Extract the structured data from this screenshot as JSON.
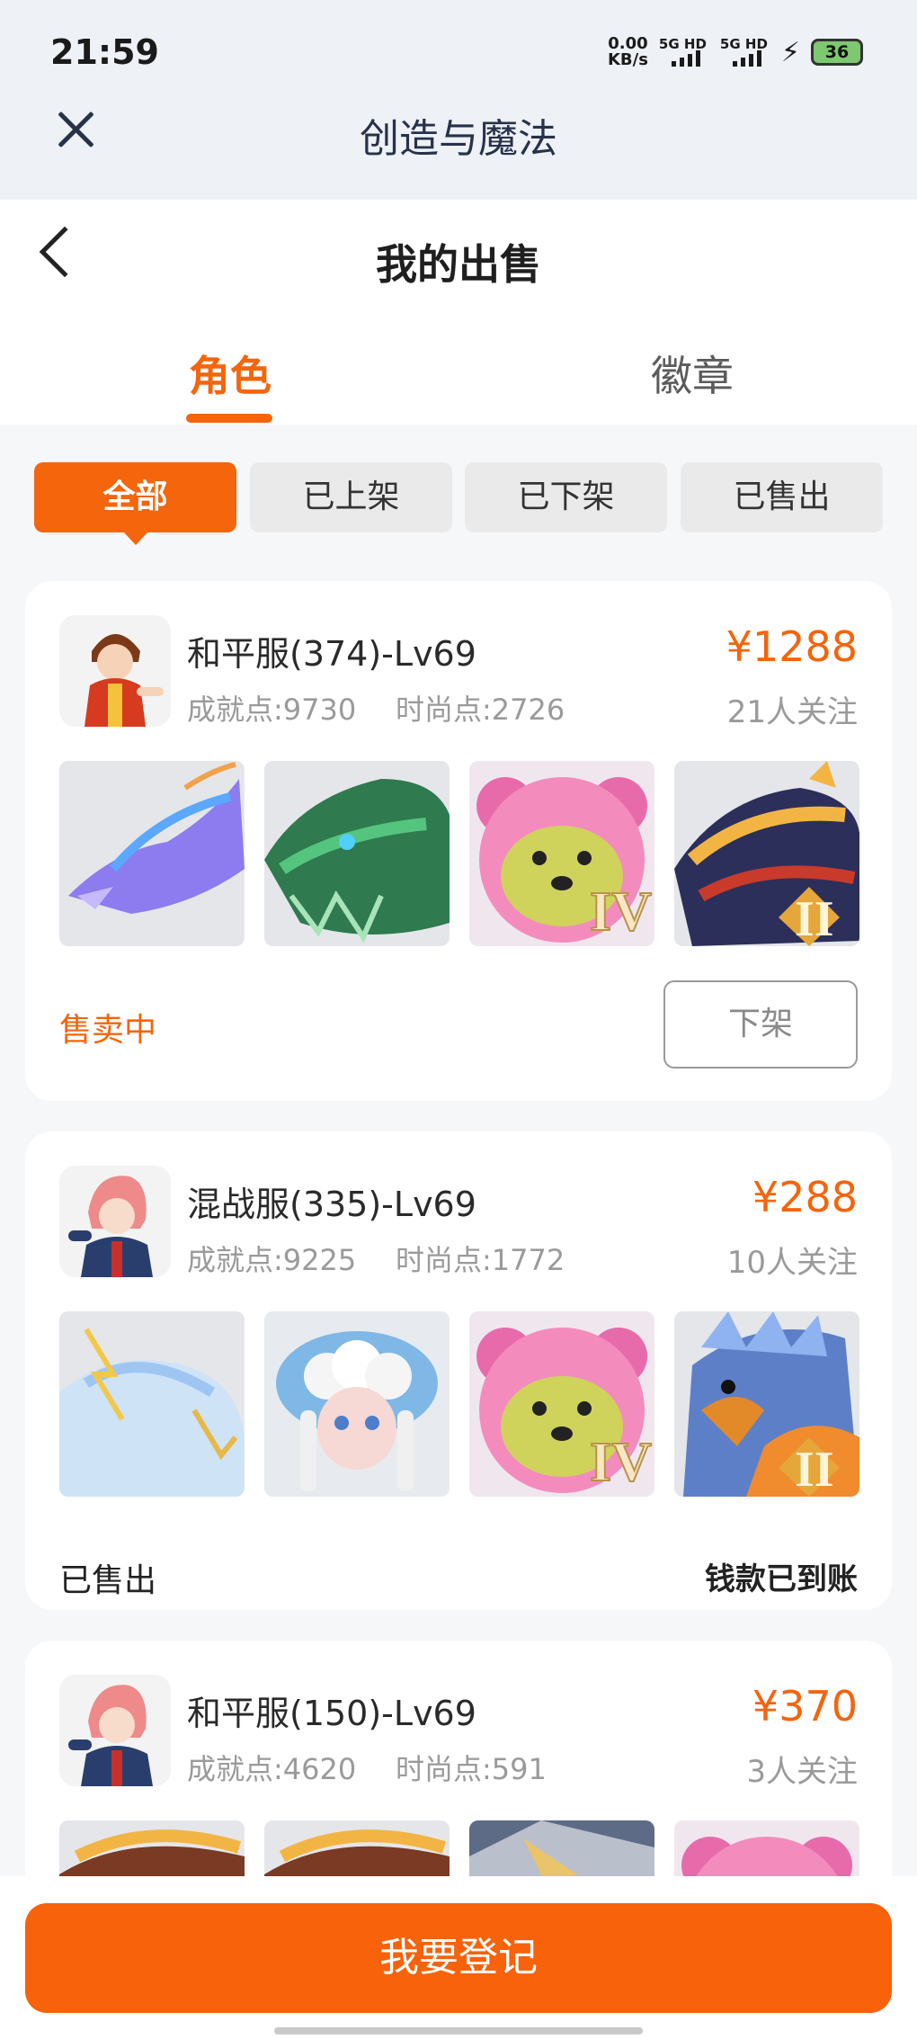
{
  "status_bar": {
    "time": "21:59",
    "net_speed_value": "0.00",
    "net_speed_unit": "KB/s",
    "sim1": "5G HD",
    "sim2": "5G HD",
    "battery": "36"
  },
  "app_bar": {
    "title": "创造与魔法",
    "close_icon": "close-icon"
  },
  "header": {
    "title": "我的出售",
    "back_icon": "back-chevron-icon"
  },
  "tabs": [
    {
      "label": "角色",
      "active": true
    },
    {
      "label": "徽章",
      "active": false
    }
  ],
  "filters": [
    {
      "label": "全部",
      "active": true
    },
    {
      "label": "已上架",
      "active": false
    },
    {
      "label": "已下架",
      "active": false
    },
    {
      "label": "已售出",
      "active": false
    }
  ],
  "listings": [
    {
      "server": "和平服(374)-Lv69",
      "achievement": "成就点:9730",
      "fashion": "时尚点:2726",
      "price": "¥1288",
      "followers": "21人关注",
      "status": "售卖中",
      "action": "下架",
      "thumbs": [
        "purple-dragon-mount",
        "green-dragon-mount",
        "pink-bear-mount",
        "fire-dragon-mount"
      ],
      "thumb_badges": [
        "",
        "",
        "IV",
        "II"
      ]
    },
    {
      "server": "混战服(335)-Lv69",
      "achievement": "成就点:9225",
      "fashion": "时尚点:1772",
      "price": "¥288",
      "followers": "10人关注",
      "status": "已售出",
      "note": "钱款已到账",
      "thumbs": [
        "ice-qilin-mount",
        "cloud-sheep-pet",
        "pink-bear-mount",
        "blue-eagle-mount"
      ],
      "thumb_badges": [
        "",
        "",
        "IV",
        "II"
      ]
    },
    {
      "server": "和平服(150)-Lv69",
      "achievement": "成就点:4620",
      "fashion": "时尚点:591",
      "price": "¥370",
      "followers": "3人关注",
      "thumbs": [
        "fire-dragon-mount",
        "fire-dragon-mount",
        "silver-mount",
        "pink-bear-mount"
      ]
    }
  ],
  "cta": {
    "label": "我要登记"
  },
  "colors": {
    "accent": "#f4650c",
    "muted": "#9a9a9a"
  }
}
